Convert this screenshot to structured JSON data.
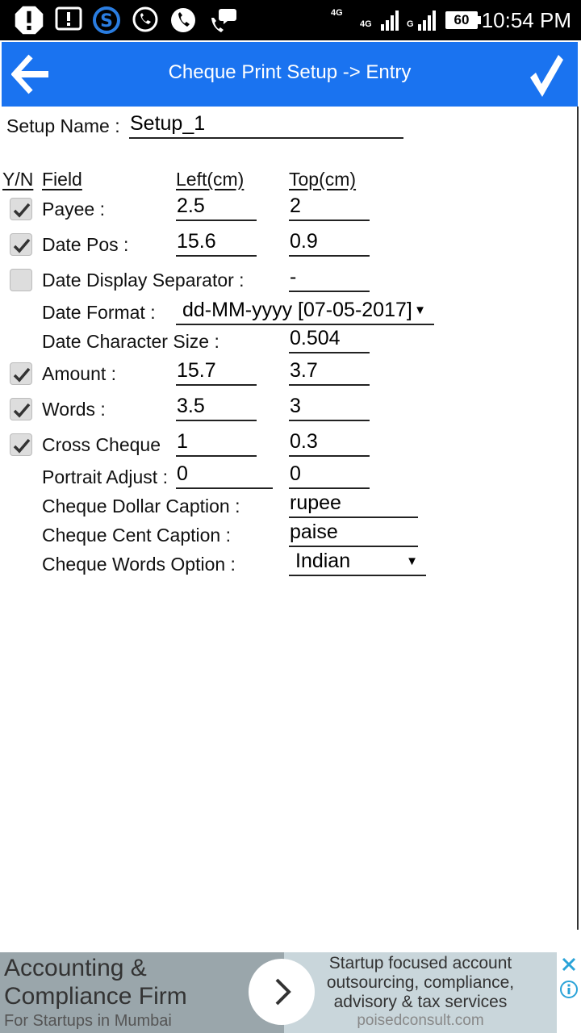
{
  "status_bar": {
    "time": "10:54 PM",
    "battery": "60",
    "net_top": "4G",
    "net1": "4G",
    "net2": "G",
    "icons": [
      "alert-icon",
      "message-alert-icon",
      "skype-icon",
      "whatsapp-icon",
      "phone-icon",
      "chat-call-icon"
    ]
  },
  "app_bar": {
    "title": "Cheque Print Setup -> Entry",
    "back_icon": "arrow-left-icon",
    "confirm_icon": "checkmark-icon",
    "color": "#1a73f0"
  },
  "form": {
    "setup_name_label": "Setup Name :",
    "setup_name_value": "Setup_1",
    "headers": {
      "yn": "Y/N",
      "field": "Field",
      "left": "Left(cm)",
      "top": "Top(cm)"
    },
    "payee": {
      "label": "Payee :",
      "left": "2.5",
      "top": "2",
      "checked": true
    },
    "date_pos": {
      "label": "Date Pos :",
      "left": "15.6",
      "top": "0.9",
      "checked": true
    },
    "date_separator": {
      "label": "Date Display Separator :",
      "value": "-",
      "checked": false
    },
    "date_format": {
      "label": "Date Format :",
      "value": "dd-MM-yyyy [07-05-2017]"
    },
    "date_char_size": {
      "label": "Date Character Size :",
      "value": "0.504"
    },
    "amount": {
      "label": "Amount :",
      "left": "15.7",
      "top": "3.7",
      "checked": true
    },
    "words": {
      "label": "Words :",
      "left": "3.5",
      "top": "3",
      "checked": true
    },
    "cross_cheque": {
      "label": "Cross Cheque",
      "left": "1",
      "top": "0.3",
      "checked": true
    },
    "portrait_adjust": {
      "label": "Portrait Adjust :",
      "left": "0",
      "top": "0"
    },
    "dollar_caption": {
      "label": "Cheque Dollar Caption :",
      "value": "rupee"
    },
    "cent_caption": {
      "label": "Cheque Cent Caption :",
      "value": "paise"
    },
    "words_option": {
      "label": "Cheque Words Option :",
      "value": "Indian"
    }
  },
  "ad": {
    "headline_1": "Accounting &",
    "headline_2": "Compliance Firm",
    "subline": "For Startups in Mumbai",
    "desc_1": "Startup focused account",
    "desc_2": "outsourcing, compliance,",
    "desc_3": "advisory & tax services",
    "domain": "poisedconsult.com"
  }
}
